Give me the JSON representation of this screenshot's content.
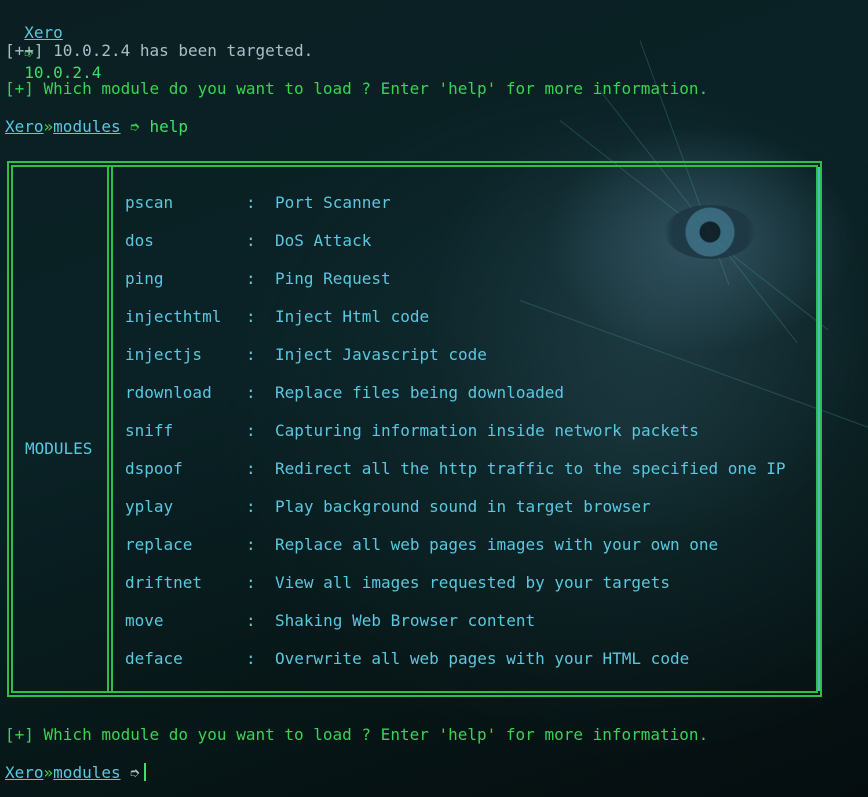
{
  "prompt1": {
    "user": "Xero",
    "arrow": "➮",
    "ip": "10.0.2.4"
  },
  "target_msg": "[++] 10.0.2.4 has been targeted.",
  "question1": "[+] Which module do you want to load ? Enter 'help' for more information.",
  "prompt2": {
    "user": "Xero",
    "sep": "»",
    "context": "modules",
    "arrow": "➮",
    "command": "help"
  },
  "table": {
    "side_label": "MODULES",
    "rows": [
      {
        "name": "pscan",
        "sep": ":",
        "desc": "Port Scanner"
      },
      {
        "name": "dos",
        "sep": ":",
        "desc": "DoS Attack"
      },
      {
        "name": "ping",
        "sep": ":",
        "desc": "Ping Request"
      },
      {
        "name": "injecthtml",
        "sep": ":",
        "desc": "Inject Html code"
      },
      {
        "name": "injectjs",
        "sep": ":",
        "desc": "Inject Javascript code"
      },
      {
        "name": "rdownload",
        "sep": ":",
        "desc": "Replace files being downloaded"
      },
      {
        "name": "sniff",
        "sep": ":",
        "desc": "Capturing information inside network packets"
      },
      {
        "name": "dspoof",
        "sep": ":",
        "desc": "Redirect all the http traffic to the specified one IP"
      },
      {
        "name": "yplay",
        "sep": ":",
        "desc": "Play background sound in target browser"
      },
      {
        "name": "replace",
        "sep": ":",
        "desc": "Replace all web pages images with your own one"
      },
      {
        "name": "driftnet",
        "sep": ":",
        "desc": "View all images requested by your targets"
      },
      {
        "name": "move",
        "sep": ":",
        "desc": "Shaking Web Browser content"
      },
      {
        "name": "deface",
        "sep": ":",
        "desc": "Overwrite all web pages with your HTML code"
      }
    ]
  },
  "question2": "[+] Which module do you want to load ? Enter 'help' for more information.",
  "prompt3": {
    "user": "Xero",
    "sep": "»",
    "context": "modules",
    "arrow": "➮",
    "command": ""
  },
  "colors": {
    "green": "#39d353",
    "cyan": "#5ac8e0",
    "gray": "#a9bfc7",
    "border": "#2fbf45"
  }
}
